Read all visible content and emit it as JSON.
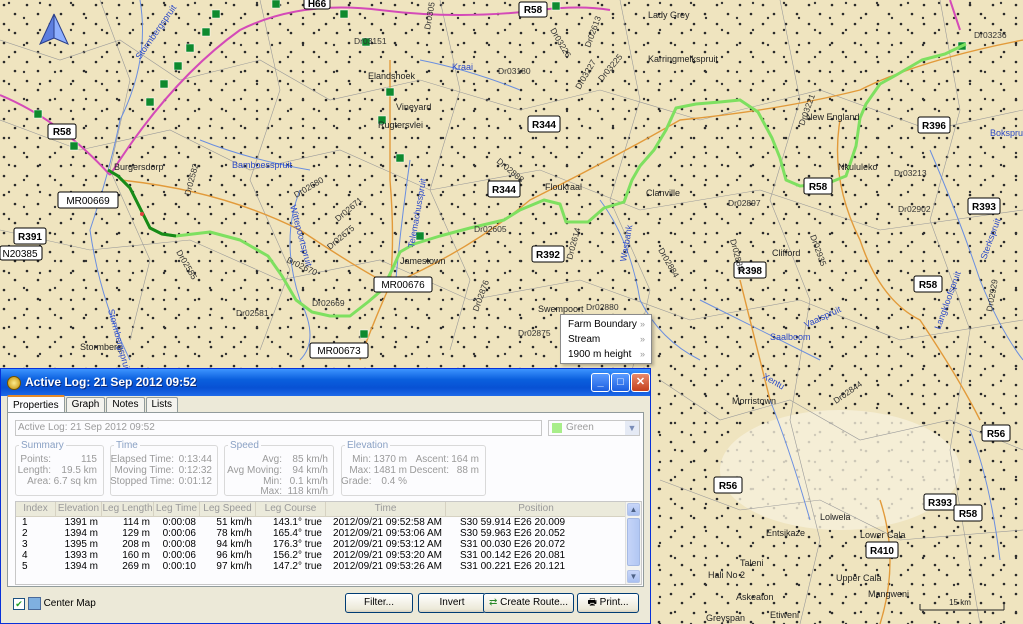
{
  "map": {
    "roads": [
      "R58",
      "R58",
      "R344",
      "R344",
      "R396",
      "R391",
      "R392",
      "R393",
      "R393",
      "R58",
      "R58",
      "R56",
      "R56",
      "R410",
      "R398",
      "MR00669",
      "MR00676",
      "MR00673",
      "MR00679",
      "N20385",
      "H66"
    ],
    "towns": [
      "Lady Grey",
      "Burgersdorp",
      "Elandshoek",
      "Vineyard",
      "Rugtersvlei",
      "Jamestown",
      "Floukraal",
      "Clanville",
      "New England",
      "Karringmelkspruit",
      "Swempoort",
      "Morristown",
      "Lower Cala",
      "Upper Cala",
      "Hali No 2",
      "Askeaton",
      "Greyspan",
      "Mangweni",
      "Etiweni",
      "Nkululeko",
      "Clifford",
      "Stormberg",
      "Lolwela",
      "Entsikaze",
      "Taleni"
    ],
    "rivers": [
      "Stormbergspruit",
      "Kraai",
      "Bamboesspruit",
      "Wittepoortspruit",
      "Telemachusspruit",
      "Wasbank",
      "Saalboom",
      "Vaalspruit",
      "Xentu",
      "Langkloofspruit",
      "Stormbergspruit",
      "Sterkspruit",
      "Bokspruit"
    ],
    "farms": [
      "Dr03151",
      "Dr03180",
      "Dr03227",
      "Dr03225",
      "Dr03226",
      "Dr02613",
      "Dr03236",
      "Dr03221",
      "Dr03213",
      "Dr02902",
      "Dr02897",
      "Dr02888",
      "Dr02585",
      "Dr02582",
      "Dr02876",
      "Dr02670",
      "Dr02669",
      "Dr02671",
      "Dr02675",
      "Dr02680",
      "Dr02880",
      "Dr02875",
      "Dr02605",
      "Dr02614",
      "Dr02884",
      "Dr02888",
      "Dr02935",
      "Dr02844",
      "Dr02929",
      "Dr0305",
      "Dr02581"
    ],
    "scale": "15 km"
  },
  "popup": {
    "items": [
      "Farm Boundary",
      "Stream",
      "1900 m height"
    ]
  },
  "window": {
    "title": "Active Log: 21 Sep 2012 09:52",
    "tabs": [
      "Properties",
      "Graph",
      "Notes",
      "Lists"
    ],
    "name_value": "Active Log: 21 Sep 2012 09:52",
    "color_value": "Green",
    "colors": {
      "track": "#7ee060",
      "trackDark": "#188a18"
    },
    "summary": {
      "legend": "Summary",
      "points_label": "Points:",
      "points": "115",
      "length_label": "Length:",
      "length": "19.5 km",
      "area_label": "Area:",
      "area": "6.7 sq km"
    },
    "time": {
      "legend": "Time",
      "elapsed_label": "Elapsed Time:",
      "elapsed": "0:13:44",
      "moving_label": "Moving Time:",
      "moving": "0:12:32",
      "stopped_label": "Stopped Time:",
      "stopped": "0:01:12"
    },
    "speed": {
      "legend": "Speed",
      "avg_label": "Avg:",
      "avg": "85 km/h",
      "avgmov_label": "Avg Moving:",
      "avgmov": "94 km/h",
      "min_label": "Min:",
      "min": "0.1 km/h",
      "max_label": "Max:",
      "max": "118 km/h"
    },
    "elevation": {
      "legend": "Elevation",
      "min_label": "Min:",
      "min": "1370 m",
      "max_label": "Max:",
      "max": "1481 m",
      "grade_label": "Grade:",
      "grade": "0.4 %",
      "ascent_label": "Ascent:",
      "ascent": "164 m",
      "descent_label": "Descent:",
      "descent": "88 m"
    },
    "table": {
      "headers": [
        "Index",
        "Elevation",
        "Leg Length",
        "Leg Time",
        "Leg Speed",
        "Leg Course",
        "Time",
        "Position"
      ],
      "rows": [
        [
          "1",
          "1391 m",
          "114 m",
          "0:00:08",
          "51 km/h",
          "143.1° true",
          "2012/09/21 09:52:58 AM",
          "S30 59.914 E26 20.009"
        ],
        [
          "2",
          "1394 m",
          "129 m",
          "0:00:06",
          "78 km/h",
          "165.4° true",
          "2012/09/21 09:53:06 AM",
          "S30 59.963 E26 20.052"
        ],
        [
          "3",
          "1395 m",
          "208 m",
          "0:00:08",
          "94 km/h",
          "176.3° true",
          "2012/09/21 09:53:12 AM",
          "S31 00.030 E26 20.072"
        ],
        [
          "4",
          "1393 m",
          "160 m",
          "0:00:06",
          "96 km/h",
          "156.2° true",
          "2012/09/21 09:53:20 AM",
          "S31 00.142 E26 20.081"
        ],
        [
          "5",
          "1394 m",
          "269 m",
          "0:00:10",
          "97 km/h",
          "147.2° true",
          "2012/09/21 09:53:26 AM",
          "S31 00.221 E26 20.121"
        ]
      ]
    },
    "center_map_label": "Center Map",
    "buttons": {
      "filter": "Filter...",
      "invert": "Invert",
      "create_route": "Create Route...",
      "print": "Print..."
    }
  }
}
